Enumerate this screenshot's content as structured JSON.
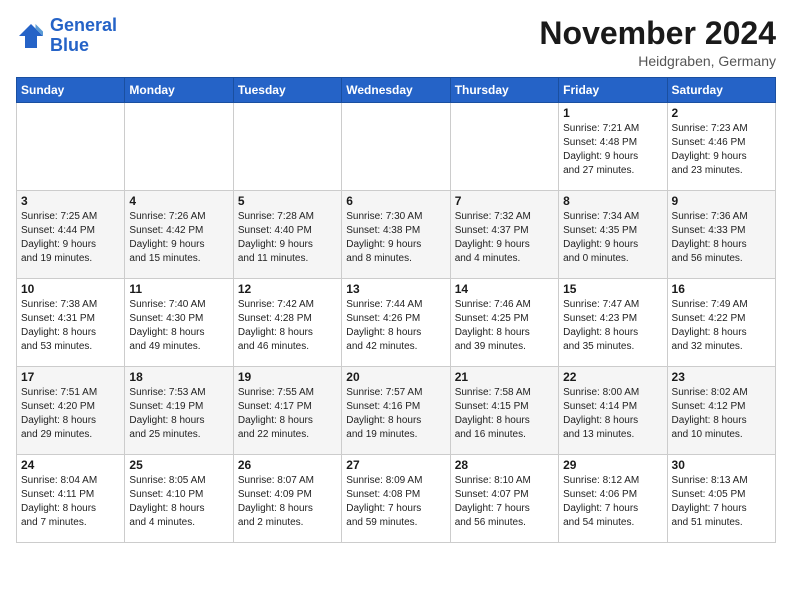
{
  "logo": {
    "line1": "General",
    "line2": "Blue"
  },
  "title": "November 2024",
  "subtitle": "Heidgraben, Germany",
  "days_of_week": [
    "Sunday",
    "Monday",
    "Tuesday",
    "Wednesday",
    "Thursday",
    "Friday",
    "Saturday"
  ],
  "weeks": [
    [
      {
        "day": "",
        "info": ""
      },
      {
        "day": "",
        "info": ""
      },
      {
        "day": "",
        "info": ""
      },
      {
        "day": "",
        "info": ""
      },
      {
        "day": "",
        "info": ""
      },
      {
        "day": "1",
        "info": "Sunrise: 7:21 AM\nSunset: 4:48 PM\nDaylight: 9 hours\nand 27 minutes."
      },
      {
        "day": "2",
        "info": "Sunrise: 7:23 AM\nSunset: 4:46 PM\nDaylight: 9 hours\nand 23 minutes."
      }
    ],
    [
      {
        "day": "3",
        "info": "Sunrise: 7:25 AM\nSunset: 4:44 PM\nDaylight: 9 hours\nand 19 minutes."
      },
      {
        "day": "4",
        "info": "Sunrise: 7:26 AM\nSunset: 4:42 PM\nDaylight: 9 hours\nand 15 minutes."
      },
      {
        "day": "5",
        "info": "Sunrise: 7:28 AM\nSunset: 4:40 PM\nDaylight: 9 hours\nand 11 minutes."
      },
      {
        "day": "6",
        "info": "Sunrise: 7:30 AM\nSunset: 4:38 PM\nDaylight: 9 hours\nand 8 minutes."
      },
      {
        "day": "7",
        "info": "Sunrise: 7:32 AM\nSunset: 4:37 PM\nDaylight: 9 hours\nand 4 minutes."
      },
      {
        "day": "8",
        "info": "Sunrise: 7:34 AM\nSunset: 4:35 PM\nDaylight: 9 hours\nand 0 minutes."
      },
      {
        "day": "9",
        "info": "Sunrise: 7:36 AM\nSunset: 4:33 PM\nDaylight: 8 hours\nand 56 minutes."
      }
    ],
    [
      {
        "day": "10",
        "info": "Sunrise: 7:38 AM\nSunset: 4:31 PM\nDaylight: 8 hours\nand 53 minutes."
      },
      {
        "day": "11",
        "info": "Sunrise: 7:40 AM\nSunset: 4:30 PM\nDaylight: 8 hours\nand 49 minutes."
      },
      {
        "day": "12",
        "info": "Sunrise: 7:42 AM\nSunset: 4:28 PM\nDaylight: 8 hours\nand 46 minutes."
      },
      {
        "day": "13",
        "info": "Sunrise: 7:44 AM\nSunset: 4:26 PM\nDaylight: 8 hours\nand 42 minutes."
      },
      {
        "day": "14",
        "info": "Sunrise: 7:46 AM\nSunset: 4:25 PM\nDaylight: 8 hours\nand 39 minutes."
      },
      {
        "day": "15",
        "info": "Sunrise: 7:47 AM\nSunset: 4:23 PM\nDaylight: 8 hours\nand 35 minutes."
      },
      {
        "day": "16",
        "info": "Sunrise: 7:49 AM\nSunset: 4:22 PM\nDaylight: 8 hours\nand 32 minutes."
      }
    ],
    [
      {
        "day": "17",
        "info": "Sunrise: 7:51 AM\nSunset: 4:20 PM\nDaylight: 8 hours\nand 29 minutes."
      },
      {
        "day": "18",
        "info": "Sunrise: 7:53 AM\nSunset: 4:19 PM\nDaylight: 8 hours\nand 25 minutes."
      },
      {
        "day": "19",
        "info": "Sunrise: 7:55 AM\nSunset: 4:17 PM\nDaylight: 8 hours\nand 22 minutes."
      },
      {
        "day": "20",
        "info": "Sunrise: 7:57 AM\nSunset: 4:16 PM\nDaylight: 8 hours\nand 19 minutes."
      },
      {
        "day": "21",
        "info": "Sunrise: 7:58 AM\nSunset: 4:15 PM\nDaylight: 8 hours\nand 16 minutes."
      },
      {
        "day": "22",
        "info": "Sunrise: 8:00 AM\nSunset: 4:14 PM\nDaylight: 8 hours\nand 13 minutes."
      },
      {
        "day": "23",
        "info": "Sunrise: 8:02 AM\nSunset: 4:12 PM\nDaylight: 8 hours\nand 10 minutes."
      }
    ],
    [
      {
        "day": "24",
        "info": "Sunrise: 8:04 AM\nSunset: 4:11 PM\nDaylight: 8 hours\nand 7 minutes."
      },
      {
        "day": "25",
        "info": "Sunrise: 8:05 AM\nSunset: 4:10 PM\nDaylight: 8 hours\nand 4 minutes."
      },
      {
        "day": "26",
        "info": "Sunrise: 8:07 AM\nSunset: 4:09 PM\nDaylight: 8 hours\nand 2 minutes."
      },
      {
        "day": "27",
        "info": "Sunrise: 8:09 AM\nSunset: 4:08 PM\nDaylight: 7 hours\nand 59 minutes."
      },
      {
        "day": "28",
        "info": "Sunrise: 8:10 AM\nSunset: 4:07 PM\nDaylight: 7 hours\nand 56 minutes."
      },
      {
        "day": "29",
        "info": "Sunrise: 8:12 AM\nSunset: 4:06 PM\nDaylight: 7 hours\nand 54 minutes."
      },
      {
        "day": "30",
        "info": "Sunrise: 8:13 AM\nSunset: 4:05 PM\nDaylight: 7 hours\nand 51 minutes."
      }
    ]
  ]
}
